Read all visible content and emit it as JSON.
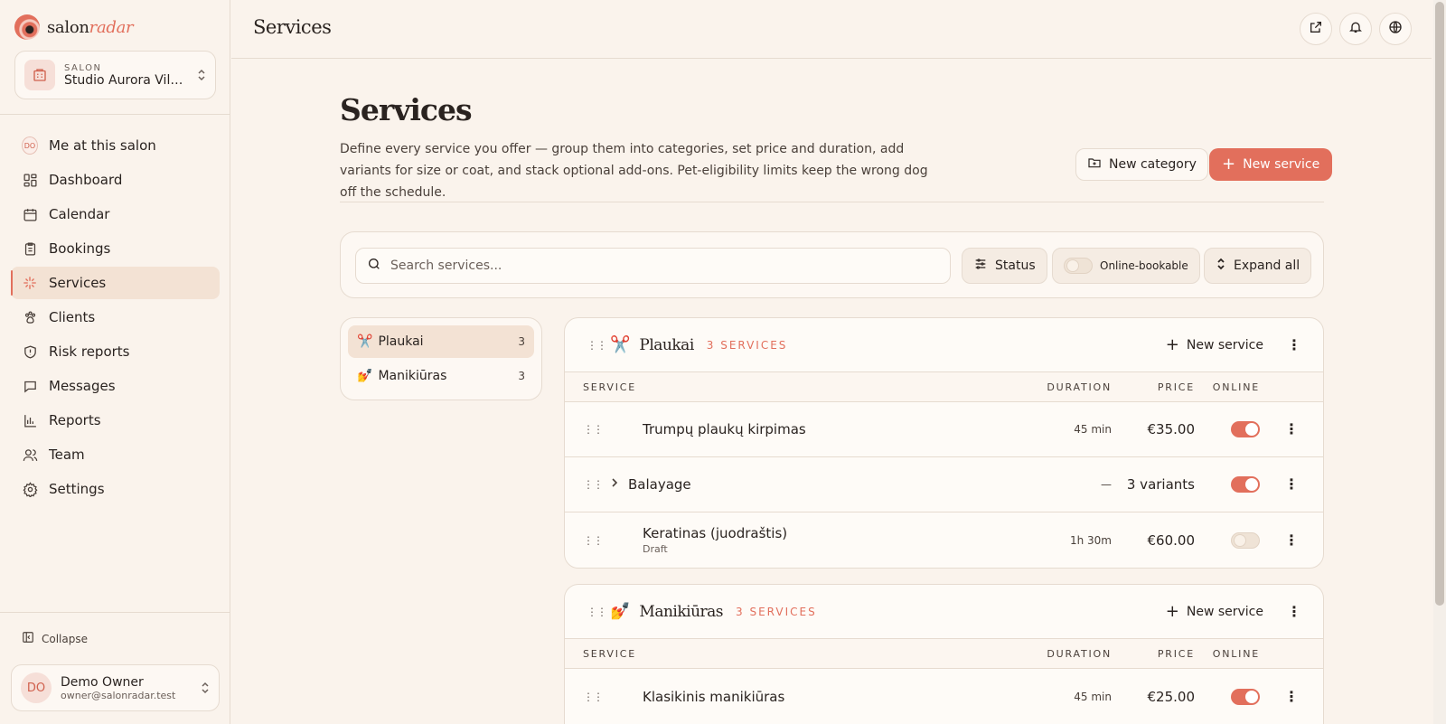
{
  "brand": {
    "name_main": "salon",
    "name_accent": "radar"
  },
  "salon_switcher": {
    "label": "SALON",
    "name": "Studio Aurora Vilnius"
  },
  "nav": {
    "me": {
      "initials": "DO",
      "label": "Me at this salon"
    },
    "items": [
      {
        "label": "Dashboard",
        "icon": "dashboard-icon"
      },
      {
        "label": "Calendar",
        "icon": "calendar-icon"
      },
      {
        "label": "Bookings",
        "icon": "clipboard-icon"
      },
      {
        "label": "Services",
        "icon": "sparkle-icon",
        "active": true
      },
      {
        "label": "Clients",
        "icon": "paw-icon"
      },
      {
        "label": "Risk reports",
        "icon": "shield-icon"
      },
      {
        "label": "Messages",
        "icon": "chat-icon"
      },
      {
        "label": "Reports",
        "icon": "bar-chart-icon"
      },
      {
        "label": "Team",
        "icon": "users-icon"
      },
      {
        "label": "Settings",
        "icon": "gear-icon"
      }
    ]
  },
  "collapse_label": "Collapse",
  "user": {
    "initials": "DO",
    "name": "Demo Owner",
    "email": "owner@salonradar.test"
  },
  "topbar": {
    "title": "Services"
  },
  "header": {
    "title": "Services",
    "description": "Define every service you offer — group them into categories, set price and duration, add variants for size or coat, and stack optional add-ons. Pet-eligibility limits keep the wrong dog off the schedule.",
    "new_category": "New category",
    "new_service": "New service"
  },
  "filters": {
    "search_placeholder": "Search services...",
    "status": "Status",
    "online_bookable": "Online-bookable",
    "online_bookable_on": false,
    "expand_all": "Expand all"
  },
  "categories": [
    {
      "emoji": "✂️",
      "name": "Plaukai",
      "count": "3",
      "active": true
    },
    {
      "emoji": "💅",
      "name": "Manikiūras",
      "count": "3",
      "active": false
    }
  ],
  "columns": {
    "service": "SERVICE",
    "duration": "DURATION",
    "price": "PRICE",
    "online": "ONLINE"
  },
  "groups": [
    {
      "emoji": "✂️",
      "name": "Plaukai",
      "count_label": "3 SERVICES",
      "new_service": "New service",
      "services": [
        {
          "name": "Trumpų plaukų kirpimas",
          "sub": "",
          "duration": "45 min",
          "price": "€35.00",
          "online": true,
          "expandable": false
        },
        {
          "name": "Balayage",
          "sub": "",
          "duration": "—",
          "price": "3 variants",
          "online": true,
          "expandable": true
        },
        {
          "name": "Keratinas (juodraštis)",
          "sub": "Draft",
          "duration": "1h 30m",
          "price": "€60.00",
          "online": false,
          "expandable": false
        }
      ]
    },
    {
      "emoji": "💅",
      "name": "Manikiūras",
      "count_label": "3 SERVICES",
      "new_service": "New service",
      "services": [
        {
          "name": "Klasikinis manikiūras",
          "sub": "",
          "duration": "45 min",
          "price": "€25.00",
          "online": true,
          "expandable": false
        }
      ]
    }
  ],
  "colors": {
    "accent": "#e26f5c",
    "background": "#faf3ec",
    "border": "#e6dbd0",
    "text": "#2a2320"
  }
}
